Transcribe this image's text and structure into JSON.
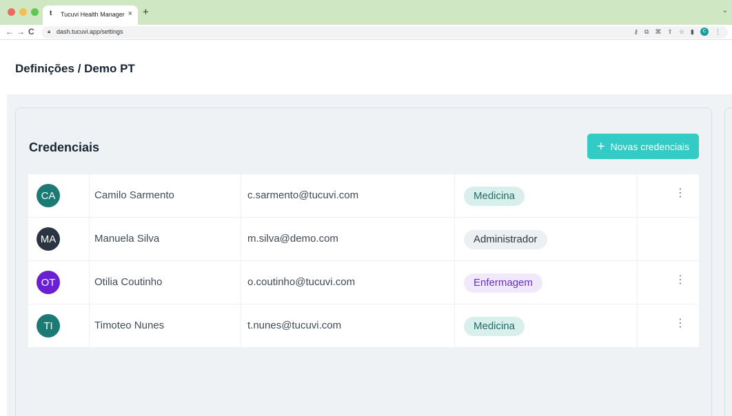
{
  "browser": {
    "tab_favicon": "t",
    "tab_title": "Tucuvi Health Manager",
    "tab_close": "×",
    "new_tab": "+",
    "url": "dash.tucuvi.app/settings",
    "profile_initial": "C"
  },
  "page": {
    "title": "Definições / Demo PT"
  },
  "credentials": {
    "title": "Credenciais",
    "new_button": "Novas credenciais",
    "users": [
      {
        "initials": "CA",
        "name": "Camilo Sarmento",
        "email": "c.sarmento@tucuvi.com",
        "role": "Medicina",
        "avatar_color": "#1c7a74",
        "role_bg": "#d9efec",
        "role_color": "#1f6b66",
        "has_menu": true
      },
      {
        "initials": "MA",
        "name": "Manuela Silva",
        "email": "m.silva@demo.com",
        "role": "Administrador",
        "avatar_color": "#2b3542",
        "role_bg": "#edf0f3",
        "role_color": "#2b3542",
        "has_menu": false
      },
      {
        "initials": "OT",
        "name": "Otilia Coutinho",
        "email": "o.coutinho@tucuvi.com",
        "role": "Enfermagem",
        "avatar_color": "#6a1fd1",
        "role_bg": "#efe9fb",
        "role_color": "#6a2fc8",
        "has_menu": true
      },
      {
        "initials": "TI",
        "name": "Timoteo Nunes",
        "email": "t.nunes@tucuvi.com",
        "role": "Medicina",
        "avatar_color": "#1c7a74",
        "role_bg": "#d9efec",
        "role_color": "#1f6b66",
        "has_menu": true
      }
    ]
  },
  "colors": {
    "accent": "#33cbc5",
    "heading": "#172433"
  }
}
